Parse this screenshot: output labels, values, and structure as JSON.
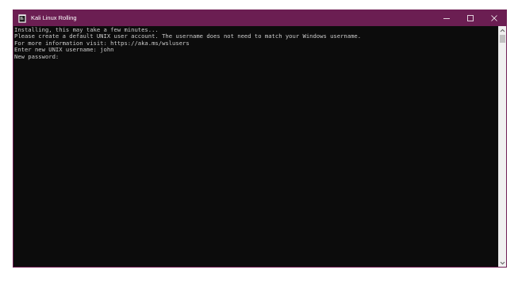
{
  "window": {
    "title": "Kali Linux Rolling",
    "app_icon": "console-app-icon",
    "titlebar_color": "#6b1e52",
    "controls": [
      "minimize-icon",
      "maximize-icon",
      "close-icon"
    ]
  },
  "terminal": {
    "background": "#0c0c0c",
    "foreground": "#cccccc",
    "lines": [
      "Installing, this may take a few minutes...",
      "Please create a default UNIX user account. The username does not need to match your Windows username.",
      "For more information visit: https://aka.ms/wslusers",
      "Enter new UNIX username: john",
      "New password:"
    ]
  },
  "scrollbar": {
    "up_icon": "chevron-up-icon",
    "down_icon": "chevron-down-icon"
  }
}
